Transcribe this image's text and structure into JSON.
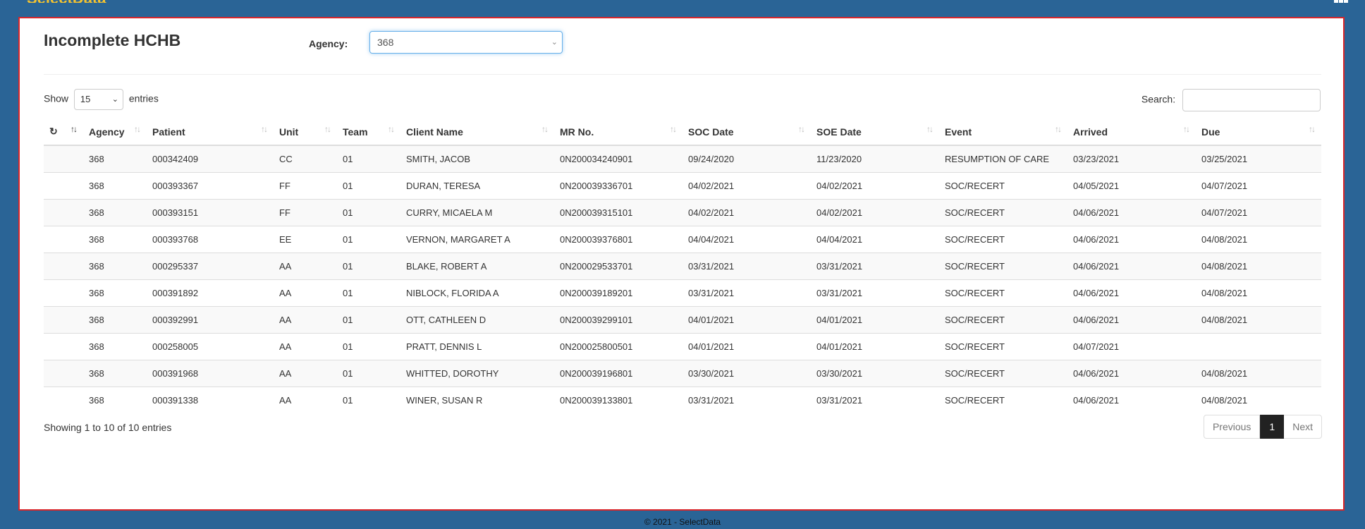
{
  "page": {
    "title": "Incomplete HCHB"
  },
  "agency": {
    "label": "Agency:",
    "value": "368"
  },
  "length": {
    "show": "Show",
    "value": "15",
    "entries": "entries"
  },
  "search": {
    "label": "Search:",
    "value": ""
  },
  "columns": [
    "Agency",
    "Patient",
    "Unit",
    "Team",
    "Client Name",
    "MR No.",
    "SOC Date",
    "SOE Date",
    "Event",
    "Arrived",
    "Due"
  ],
  "rows": [
    [
      "368",
      "000342409",
      "CC",
      "01",
      "SMITH, JACOB",
      "0N200034240901",
      "09/24/2020",
      "11/23/2020",
      "RESUMPTION OF CARE",
      "03/23/2021",
      "03/25/2021"
    ],
    [
      "368",
      "000393367",
      "FF",
      "01",
      "DURAN, TERESA",
      "0N200039336701",
      "04/02/2021",
      "04/02/2021",
      "SOC/RECERT",
      "04/05/2021",
      "04/07/2021"
    ],
    [
      "368",
      "000393151",
      "FF",
      "01",
      "CURRY, MICAELA M",
      "0N200039315101",
      "04/02/2021",
      "04/02/2021",
      "SOC/RECERT",
      "04/06/2021",
      "04/07/2021"
    ],
    [
      "368",
      "000393768",
      "EE",
      "01",
      "VERNON, MARGARET A",
      "0N200039376801",
      "04/04/2021",
      "04/04/2021",
      "SOC/RECERT",
      "04/06/2021",
      "04/08/2021"
    ],
    [
      "368",
      "000295337",
      "AA",
      "01",
      "BLAKE, ROBERT A",
      "0N200029533701",
      "03/31/2021",
      "03/31/2021",
      "SOC/RECERT",
      "04/06/2021",
      "04/08/2021"
    ],
    [
      "368",
      "000391892",
      "AA",
      "01",
      "NIBLOCK, FLORIDA A",
      "0N200039189201",
      "03/31/2021",
      "03/31/2021",
      "SOC/RECERT",
      "04/06/2021",
      "04/08/2021"
    ],
    [
      "368",
      "000392991",
      "AA",
      "01",
      "OTT, CATHLEEN D",
      "0N200039299101",
      "04/01/2021",
      "04/01/2021",
      "SOC/RECERT",
      "04/06/2021",
      "04/08/2021"
    ],
    [
      "368",
      "000258005",
      "AA",
      "01",
      "PRATT, DENNIS L",
      "0N200025800501",
      "04/01/2021",
      "04/01/2021",
      "SOC/RECERT",
      "04/07/2021",
      ""
    ],
    [
      "368",
      "000391968",
      "AA",
      "01",
      "WHITTED, DOROTHY",
      "0N200039196801",
      "03/30/2021",
      "03/30/2021",
      "SOC/RECERT",
      "04/06/2021",
      "04/08/2021"
    ],
    [
      "368",
      "000391338",
      "AA",
      "01",
      "WINER, SUSAN R",
      "0N200039133801",
      "03/31/2021",
      "03/31/2021",
      "SOC/RECERT",
      "04/06/2021",
      "04/08/2021"
    ]
  ],
  "info": "Showing 1 to 10 of 10 entries",
  "pager": {
    "previous": "Previous",
    "current": "1",
    "next": "Next"
  },
  "footer": "© 2021 - SelectData",
  "icons": {
    "refresh": "refresh-icon",
    "sort": "sort-icon",
    "apps": "grid-icon"
  },
  "colors": {
    "background": "#2a6496",
    "panel_border": "#d9262a",
    "pager_active": "#222222"
  }
}
